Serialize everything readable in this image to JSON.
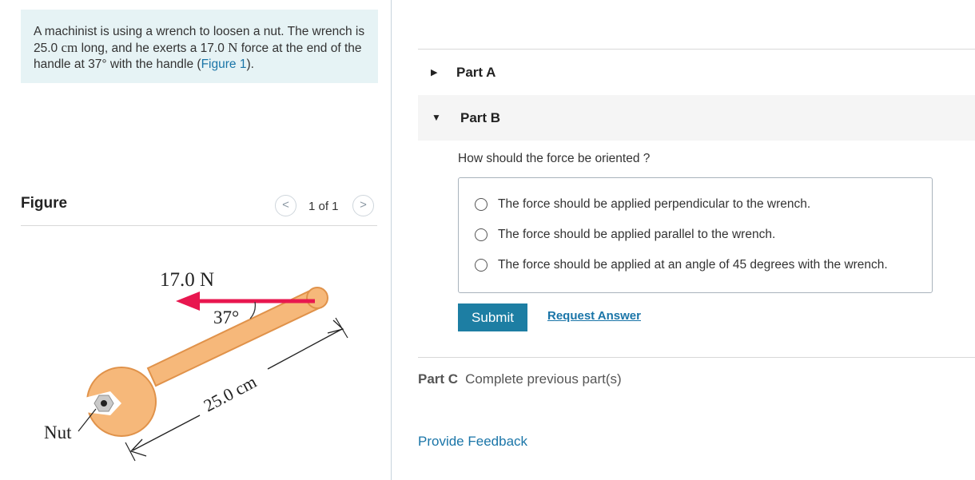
{
  "problem": {
    "text_1": "A machinist is using a wrench to loosen a nut. The wrench is 25.0 ",
    "unit_cm": "cm",
    "text_2": " long, and he exerts a 17.0 ",
    "unit_n": "N",
    "text_3": " force at the end of the handle at 37° with the handle (",
    "figure_link": "Figure 1",
    "text_4": ")."
  },
  "figure": {
    "title": "Figure",
    "pager": "1 of 1",
    "prev_icon": "chevron-left-icon",
    "next_icon": "chevron-right-icon",
    "force_label": "17.0 N",
    "angle_label": "37°",
    "length_label": "25.0 cm",
    "nut_label": "Nut",
    "colors": {
      "wrench": "#f6b87a",
      "wrench_stroke": "#e0924a",
      "arrow": "#e8174f",
      "nut": "#c9c9c9"
    }
  },
  "parts": {
    "part_a": {
      "label": "Part A",
      "icon": "triangle-right-icon"
    },
    "part_b": {
      "label": "Part B",
      "icon": "triangle-down-icon"
    },
    "part_c": {
      "label": "Part C",
      "status": "Complete previous part(s)"
    }
  },
  "question": {
    "prompt": "How should the force be oriented ?",
    "options": [
      "The force should be applied perpendicular to the wrench.",
      "The force should be applied parallel to the wrench.",
      "The force should be applied at an angle of 45 degrees with the wrench."
    ],
    "submit_label": "Submit",
    "request_label": "Request Answer"
  },
  "feedback_label": "Provide Feedback",
  "colors": {
    "accent": "#1d7ea3",
    "link": "#1a75a8",
    "problem_bg": "#e6f3f5"
  }
}
